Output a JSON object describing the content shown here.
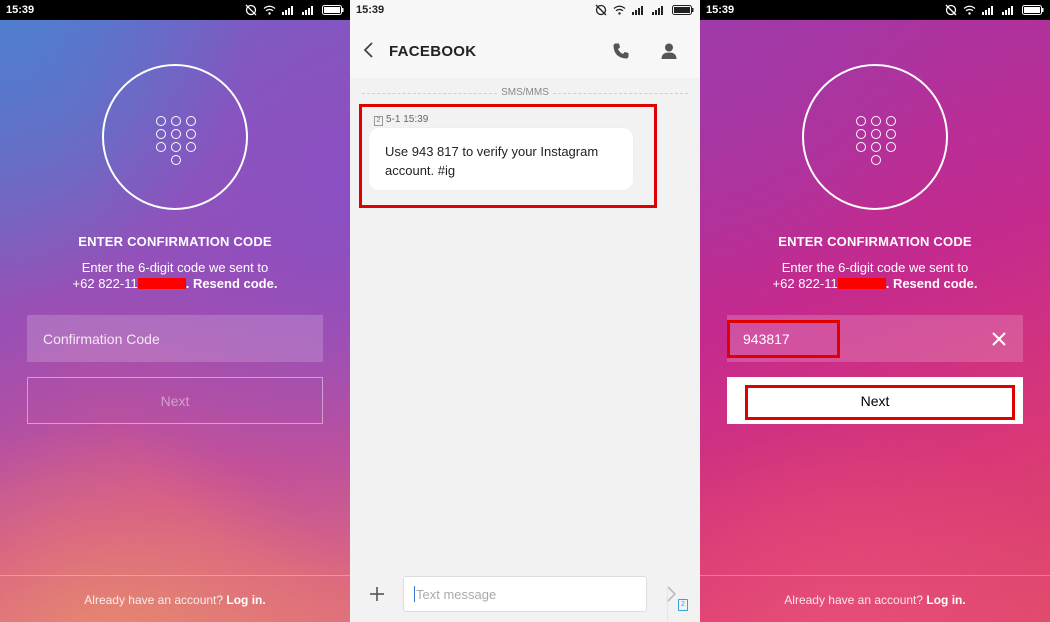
{
  "status": {
    "time": "15:39"
  },
  "confirm": {
    "title": "ENTER CONFIRMATION CODE",
    "desc_line1": "Enter the 6-digit code we sent to",
    "phone_prefix": "+62 822-11",
    "resend": ". Resend code.",
    "placeholder": "Confirmation Code",
    "next_label": "Next",
    "login_prompt": "Already have an account?",
    "login_link": "Log in."
  },
  "sms": {
    "sender": "FACEBOOK",
    "section_label": "SMS/MMS",
    "sim_slot": "2",
    "timestamp": "5-1 15:39",
    "message": "Use 943 817 to verify your Instagram account. #ig",
    "composer_placeholder": "Text message"
  },
  "filled": {
    "code_value": "943817"
  },
  "colors": {
    "highlight": "#e00000",
    "redaction": "#ff0000",
    "accent_blue": "#3aa0d8"
  },
  "icons": [
    "keypad-icon",
    "back-icon",
    "phone-icon",
    "person-icon",
    "plus-icon",
    "send-icon",
    "clear-icon",
    "wifi-icon",
    "signal-icon",
    "battery-icon",
    "alarm-off-icon"
  ]
}
